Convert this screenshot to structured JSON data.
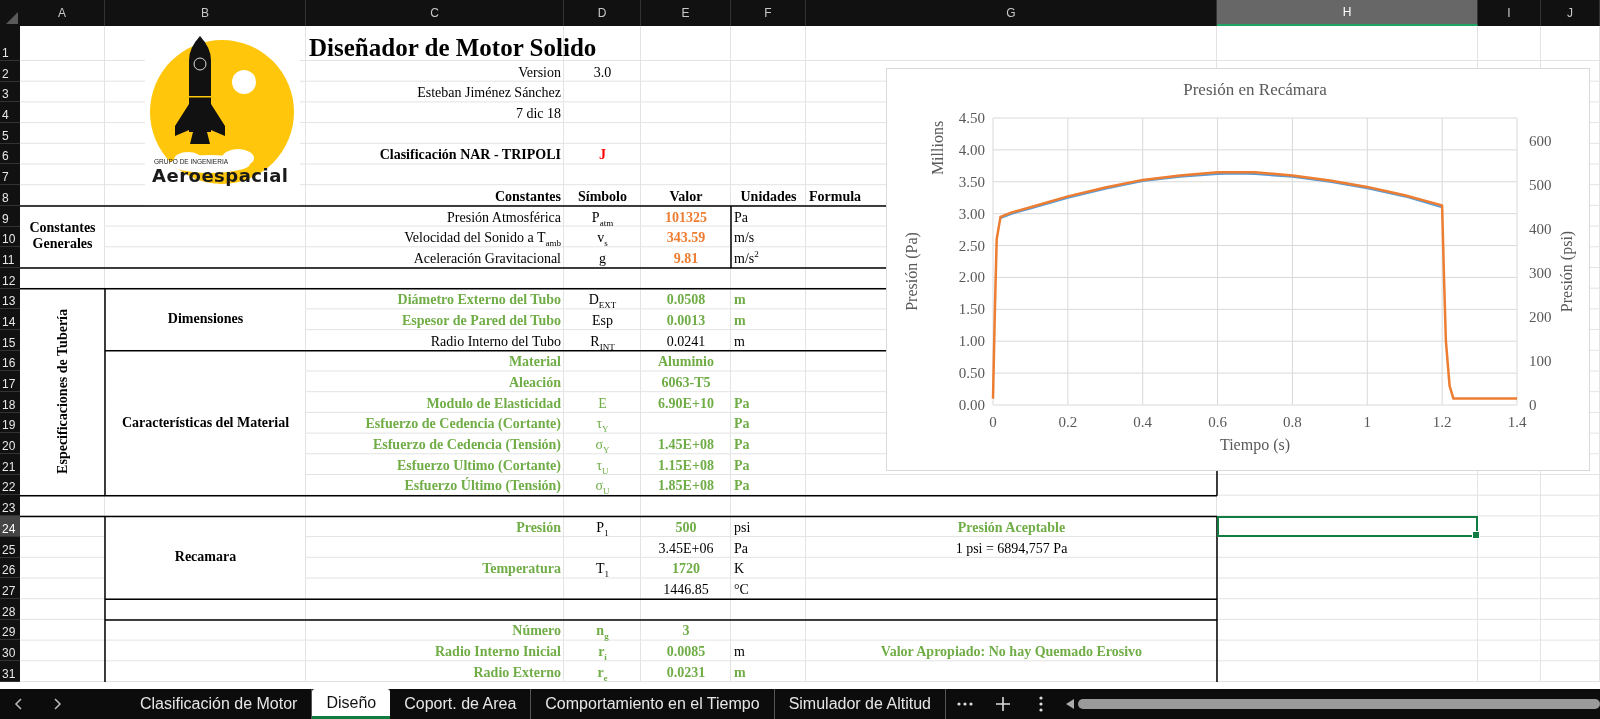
{
  "columns": [
    {
      "label": "A",
      "selected": false
    },
    {
      "label": "B",
      "selected": false
    },
    {
      "label": "C",
      "selected": false
    },
    {
      "label": "D",
      "selected": false
    },
    {
      "label": "E",
      "selected": false
    },
    {
      "label": "F",
      "selected": false
    },
    {
      "label": "G",
      "selected": false
    },
    {
      "label": "H",
      "selected": true
    },
    {
      "label": "I",
      "selected": false
    },
    {
      "label": "J",
      "selected": false
    }
  ],
  "logo": {
    "caption": "GRUPO DE INGENIERIA",
    "name": "Aeroespacial"
  },
  "rows": [
    {
      "number": "1",
      "selected": false,
      "C": {
        "text": "Diseñador de Motor Solido",
        "kind": "title"
      }
    },
    {
      "number": "2",
      "selected": false,
      "C": {
        "text": "Version",
        "kind": "plain"
      },
      "D": {
        "text": "3.0",
        "kind": "plain"
      }
    },
    {
      "number": "3",
      "selected": false,
      "C": {
        "text": "Esteban Jiménez Sánchez",
        "kind": "plain"
      }
    },
    {
      "number": "4",
      "selected": false,
      "C": {
        "text": "7 dic 18",
        "kind": "plain"
      }
    },
    {
      "number": "5",
      "selected": false
    },
    {
      "number": "6",
      "selected": false,
      "C": {
        "text": "Clasificación NAR - TRIPOLI",
        "kind": "bold"
      },
      "D": {
        "text": "J",
        "kind": "alert"
      }
    },
    {
      "number": "7",
      "selected": false
    },
    {
      "number": "8",
      "selected": false,
      "C": {
        "text": "Constantes",
        "kind": "bold"
      },
      "D": {
        "text": "Símbolo",
        "kind": "bold"
      },
      "E": {
        "text": "Valor",
        "kind": "bold"
      },
      "F": {
        "text": "Unidades",
        "kind": "bold"
      },
      "G": {
        "text": "Formula",
        "kind": "bold"
      }
    },
    {
      "number": "9",
      "selected": false,
      "A": {
        "text": "Constantes Generales",
        "kind": "bold"
      },
      "C": {
        "text": "Presión Atmosférica",
        "kind": "plain"
      },
      "D": {
        "text": "P$_{atm}$",
        "kind": "plain"
      },
      "E": {
        "text": "101325",
        "kind": "constant"
      },
      "F": {
        "text": "Pa",
        "kind": "plain"
      }
    },
    {
      "number": "10",
      "selected": false,
      "C": {
        "text": "Velocidad del Sonido a T$_{amb}$",
        "kind": "plain"
      },
      "D": {
        "text": "v$_{s}$",
        "kind": "plain"
      },
      "E": {
        "text": "343.59",
        "kind": "constant"
      },
      "F": {
        "text": "m/s",
        "kind": "plain"
      }
    },
    {
      "number": "11",
      "selected": false,
      "C": {
        "text": "Aceleración Gravitacional",
        "kind": "plain"
      },
      "D": {
        "text": "g",
        "kind": "plain"
      },
      "E": {
        "text": "9.81",
        "kind": "constant"
      },
      "F": {
        "text": "m/s$^{2}$",
        "kind": "plain"
      }
    },
    {
      "number": "12",
      "selected": false
    },
    {
      "number": "13",
      "selected": false,
      "A": {
        "text": "Especificaciones de Tubería",
        "kind": "vertical"
      },
      "B": {
        "text": "Dimensiones",
        "kind": "bold"
      },
      "C": {
        "text": "Diámetro Externo del Tubo",
        "kind": "input"
      },
      "D": {
        "text": "D$_{EXT}$",
        "kind": "plain"
      },
      "E": {
        "text": "0.0508",
        "kind": "input"
      },
      "F": {
        "text": "m",
        "kind": "input"
      }
    },
    {
      "number": "14",
      "selected": false,
      "C": {
        "text": "Espesor de Pared del Tubo",
        "kind": "input"
      },
      "D": {
        "text": "Esp",
        "kind": "plain"
      },
      "E": {
        "text": "0.0013",
        "kind": "input"
      },
      "F": {
        "text": "m",
        "kind": "input"
      }
    },
    {
      "number": "15",
      "selected": false,
      "C": {
        "text": "Radio Interno del Tubo",
        "kind": "plain"
      },
      "D": {
        "text": "R$_{INT}$",
        "kind": "plain"
      },
      "E": {
        "text": "0.0241",
        "kind": "plain"
      },
      "F": {
        "text": "m",
        "kind": "plain"
      }
    },
    {
      "number": "16",
      "selected": false,
      "B": {
        "text": "Características del Material",
        "kind": "bold"
      },
      "C": {
        "text": "Material",
        "kind": "input"
      },
      "E": {
        "text": "Aluminio",
        "kind": "input"
      }
    },
    {
      "number": "17",
      "selected": false,
      "C": {
        "text": "Aleación",
        "kind": "input"
      },
      "E": {
        "text": "6063-T5",
        "kind": "input"
      }
    },
    {
      "number": "18",
      "selected": false,
      "C": {
        "text": "Modulo de Elasticidad",
        "kind": "input"
      },
      "D": {
        "text": "E",
        "kind": "input_light"
      },
      "E": {
        "text": "6.90E+10",
        "kind": "input"
      },
      "F": {
        "text": "Pa",
        "kind": "input"
      }
    },
    {
      "number": "19",
      "selected": false,
      "C": {
        "text": "Esfuerzo de Cedencia (Cortante)",
        "kind": "input"
      },
      "D": {
        "text": "τ$_{Y}$",
        "kind": "input_light"
      },
      "F": {
        "text": "Pa",
        "kind": "input"
      }
    },
    {
      "number": "20",
      "selected": false,
      "C": {
        "text": "Esfuerzo de Cedencia (Tensión)",
        "kind": "input"
      },
      "D": {
        "text": "σ$_{Y}$",
        "kind": "input_light"
      },
      "E": {
        "text": "1.45E+08",
        "kind": "input"
      },
      "F": {
        "text": "Pa",
        "kind": "input"
      }
    },
    {
      "number": "21",
      "selected": false,
      "C": {
        "text": "Esfuerzo Ultimo (Cortante)",
        "kind": "input"
      },
      "D": {
        "text": "τ$_{U}$",
        "kind": "input_light"
      },
      "E": {
        "text": "1.15E+08",
        "kind": "input"
      },
      "F": {
        "text": "Pa",
        "kind": "input"
      }
    },
    {
      "number": "22",
      "selected": false,
      "C": {
        "text": "Esfuerzo Último (Tensión)",
        "kind": "input"
      },
      "D": {
        "text": "σ$_{U}$",
        "kind": "input_light"
      },
      "E": {
        "text": "1.85E+08",
        "kind": "input"
      },
      "F": {
        "text": "Pa",
        "kind": "input"
      }
    },
    {
      "number": "23",
      "selected": false
    },
    {
      "number": "24",
      "selected": true,
      "B": {
        "text": "Recamara",
        "kind": "bold"
      },
      "C": {
        "text": "Presión",
        "kind": "input"
      },
      "D": {
        "text": "P$_{1}$",
        "kind": "plain"
      },
      "E": {
        "text": "500",
        "kind": "input"
      },
      "F": {
        "text": "psi",
        "kind": "plain"
      },
      "G": {
        "text": "Presión Aceptable",
        "kind": "input"
      }
    },
    {
      "number": "25",
      "selected": false,
      "E": {
        "text": "3.45E+06",
        "kind": "plain"
      },
      "F": {
        "text": "Pa",
        "kind": "plain"
      },
      "G": {
        "text": "1 psi = 6894,757 Pa",
        "kind": "plain"
      }
    },
    {
      "number": "26",
      "selected": false,
      "C": {
        "text": "Temperatura",
        "kind": "input"
      },
      "D": {
        "text": "T$_{1}$",
        "kind": "plain"
      },
      "E": {
        "text": "1720",
        "kind": "input"
      },
      "F": {
        "text": "K",
        "kind": "plain"
      }
    },
    {
      "number": "27",
      "selected": false,
      "E": {
        "text": "1446.85",
        "kind": "plain"
      },
      "F": {
        "text": "°C",
        "kind": "plain"
      }
    },
    {
      "number": "28",
      "selected": false
    },
    {
      "number": "29",
      "selected": false,
      "C": {
        "text": "Número",
        "kind": "input"
      },
      "D": {
        "text": "n$_{g}$",
        "kind": "input"
      },
      "E": {
        "text": "3",
        "kind": "input"
      }
    },
    {
      "number": "30",
      "selected": false,
      "C": {
        "text": "Radio Interno Inicial",
        "kind": "input"
      },
      "D": {
        "text": "r$_{i}$",
        "kind": "input"
      },
      "E": {
        "text": "0.0085",
        "kind": "input"
      },
      "F": {
        "text": "m",
        "kind": "plain"
      },
      "G": {
        "text": "Valor Apropiado: No hay Quemado Erosivo",
        "kind": "input"
      }
    },
    {
      "number": "31",
      "selected": false,
      "C": {
        "text": "Radio Externo",
        "kind": "input"
      },
      "D": {
        "text": "r$_{e}$",
        "kind": "input"
      },
      "E": {
        "text": "0.0231",
        "kind": "input"
      },
      "F": {
        "text": "m",
        "kind": "input"
      }
    }
  ],
  "chart": {
    "units_label": "Millions",
    "secondary_axis": {
      "label": "Presión (psi)",
      "ticks": [
        "600",
        "500",
        "400",
        "300",
        "200",
        "100",
        "0"
      ]
    },
    "chart_data": {
      "type": "line",
      "title": "Presión en Recámara",
      "xlabel": "Tiempo (s)",
      "ylabel": "Presión (Pa)",
      "grid": true,
      "x": [
        0,
        0.005,
        0.01,
        0.02,
        0.05,
        0.1,
        0.2,
        0.3,
        0.4,
        0.5,
        0.6,
        0.65,
        0.7,
        0.8,
        0.9,
        1.0,
        1.1,
        1.2,
        1.205,
        1.21,
        1.22,
        1.23,
        1.3,
        1.4
      ],
      "series": [
        {
          "color": "#5b9bd5",
          "values": [
            null,
            null,
            null,
            2.93,
            3.0,
            3.08,
            3.25,
            3.39,
            3.51,
            3.58,
            3.62,
            3.63,
            3.62,
            3.58,
            3.5,
            3.4,
            3.27,
            3.1,
            null,
            null,
            null,
            null,
            null,
            null
          ]
        },
        {
          "color": "#ed7d31",
          "values": [
            0.1,
            1.5,
            2.6,
            2.95,
            3.02,
            3.1,
            3.27,
            3.41,
            3.53,
            3.6,
            3.65,
            3.65,
            3.65,
            3.6,
            3.52,
            3.42,
            3.29,
            3.13,
            2.0,
            1.0,
            0.3,
            0.1,
            0.1,
            0.1
          ]
        }
      ],
      "xlim": [
        0,
        1.4
      ],
      "ylim": [
        0,
        4.5
      ],
      "xticks": [
        0,
        0.2,
        0.4,
        0.6,
        0.8,
        1,
        1.2,
        1.4
      ],
      "yticks": [
        {
          "value": 0,
          "label": "0.00"
        },
        {
          "value": 0.5,
          "label": "0.50"
        },
        {
          "value": 1,
          "label": "1.00"
        },
        {
          "value": 1.5,
          "label": "1.50"
        },
        {
          "value": 2,
          "label": "2.00"
        },
        {
          "value": 2.5,
          "label": "2.50"
        },
        {
          "value": 3,
          "label": "3.00"
        },
        {
          "value": 3.5,
          "label": "3.50"
        },
        {
          "value": 4,
          "label": "4.00"
        },
        {
          "value": 4.5,
          "label": "4.50"
        }
      ]
    }
  },
  "tabs": [
    {
      "label": "Clasificación de Motor",
      "selected": false
    },
    {
      "label": "Diseño",
      "selected": true
    },
    {
      "label": "Coport. de Area",
      "selected": false
    },
    {
      "label": "Comportamiento en el Tiempo",
      "selected": false
    },
    {
      "label": "Simulador de Altitud",
      "selected": false
    }
  ]
}
